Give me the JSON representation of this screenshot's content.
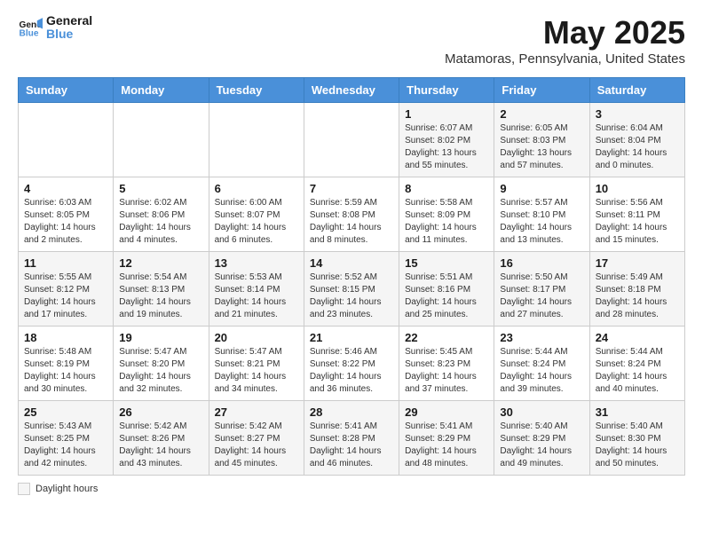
{
  "header": {
    "logo_line1": "General",
    "logo_line2": "Blue",
    "title": "May 2025",
    "subtitle": "Matamoras, Pennsylvania, United States"
  },
  "days_of_week": [
    "Sunday",
    "Monday",
    "Tuesday",
    "Wednesday",
    "Thursday",
    "Friday",
    "Saturday"
  ],
  "weeks": [
    [
      {
        "day": "",
        "info": ""
      },
      {
        "day": "",
        "info": ""
      },
      {
        "day": "",
        "info": ""
      },
      {
        "day": "",
        "info": ""
      },
      {
        "day": "1",
        "info": "Sunrise: 6:07 AM\nSunset: 8:02 PM\nDaylight: 13 hours\nand 55 minutes."
      },
      {
        "day": "2",
        "info": "Sunrise: 6:05 AM\nSunset: 8:03 PM\nDaylight: 13 hours\nand 57 minutes."
      },
      {
        "day": "3",
        "info": "Sunrise: 6:04 AM\nSunset: 8:04 PM\nDaylight: 14 hours\nand 0 minutes."
      }
    ],
    [
      {
        "day": "4",
        "info": "Sunrise: 6:03 AM\nSunset: 8:05 PM\nDaylight: 14 hours\nand 2 minutes."
      },
      {
        "day": "5",
        "info": "Sunrise: 6:02 AM\nSunset: 8:06 PM\nDaylight: 14 hours\nand 4 minutes."
      },
      {
        "day": "6",
        "info": "Sunrise: 6:00 AM\nSunset: 8:07 PM\nDaylight: 14 hours\nand 6 minutes."
      },
      {
        "day": "7",
        "info": "Sunrise: 5:59 AM\nSunset: 8:08 PM\nDaylight: 14 hours\nand 8 minutes."
      },
      {
        "day": "8",
        "info": "Sunrise: 5:58 AM\nSunset: 8:09 PM\nDaylight: 14 hours\nand 11 minutes."
      },
      {
        "day": "9",
        "info": "Sunrise: 5:57 AM\nSunset: 8:10 PM\nDaylight: 14 hours\nand 13 minutes."
      },
      {
        "day": "10",
        "info": "Sunrise: 5:56 AM\nSunset: 8:11 PM\nDaylight: 14 hours\nand 15 minutes."
      }
    ],
    [
      {
        "day": "11",
        "info": "Sunrise: 5:55 AM\nSunset: 8:12 PM\nDaylight: 14 hours\nand 17 minutes."
      },
      {
        "day": "12",
        "info": "Sunrise: 5:54 AM\nSunset: 8:13 PM\nDaylight: 14 hours\nand 19 minutes."
      },
      {
        "day": "13",
        "info": "Sunrise: 5:53 AM\nSunset: 8:14 PM\nDaylight: 14 hours\nand 21 minutes."
      },
      {
        "day": "14",
        "info": "Sunrise: 5:52 AM\nSunset: 8:15 PM\nDaylight: 14 hours\nand 23 minutes."
      },
      {
        "day": "15",
        "info": "Sunrise: 5:51 AM\nSunset: 8:16 PM\nDaylight: 14 hours\nand 25 minutes."
      },
      {
        "day": "16",
        "info": "Sunrise: 5:50 AM\nSunset: 8:17 PM\nDaylight: 14 hours\nand 27 minutes."
      },
      {
        "day": "17",
        "info": "Sunrise: 5:49 AM\nSunset: 8:18 PM\nDaylight: 14 hours\nand 28 minutes."
      }
    ],
    [
      {
        "day": "18",
        "info": "Sunrise: 5:48 AM\nSunset: 8:19 PM\nDaylight: 14 hours\nand 30 minutes."
      },
      {
        "day": "19",
        "info": "Sunrise: 5:47 AM\nSunset: 8:20 PM\nDaylight: 14 hours\nand 32 minutes."
      },
      {
        "day": "20",
        "info": "Sunrise: 5:47 AM\nSunset: 8:21 PM\nDaylight: 14 hours\nand 34 minutes."
      },
      {
        "day": "21",
        "info": "Sunrise: 5:46 AM\nSunset: 8:22 PM\nDaylight: 14 hours\nand 36 minutes."
      },
      {
        "day": "22",
        "info": "Sunrise: 5:45 AM\nSunset: 8:23 PM\nDaylight: 14 hours\nand 37 minutes."
      },
      {
        "day": "23",
        "info": "Sunrise: 5:44 AM\nSunset: 8:24 PM\nDaylight: 14 hours\nand 39 minutes."
      },
      {
        "day": "24",
        "info": "Sunrise: 5:44 AM\nSunset: 8:24 PM\nDaylight: 14 hours\nand 40 minutes."
      }
    ],
    [
      {
        "day": "25",
        "info": "Sunrise: 5:43 AM\nSunset: 8:25 PM\nDaylight: 14 hours\nand 42 minutes."
      },
      {
        "day": "26",
        "info": "Sunrise: 5:42 AM\nSunset: 8:26 PM\nDaylight: 14 hours\nand 43 minutes."
      },
      {
        "day": "27",
        "info": "Sunrise: 5:42 AM\nSunset: 8:27 PM\nDaylight: 14 hours\nand 45 minutes."
      },
      {
        "day": "28",
        "info": "Sunrise: 5:41 AM\nSunset: 8:28 PM\nDaylight: 14 hours\nand 46 minutes."
      },
      {
        "day": "29",
        "info": "Sunrise: 5:41 AM\nSunset: 8:29 PM\nDaylight: 14 hours\nand 48 minutes."
      },
      {
        "day": "30",
        "info": "Sunrise: 5:40 AM\nSunset: 8:29 PM\nDaylight: 14 hours\nand 49 minutes."
      },
      {
        "day": "31",
        "info": "Sunrise: 5:40 AM\nSunset: 8:30 PM\nDaylight: 14 hours\nand 50 minutes."
      }
    ]
  ],
  "legend": {
    "label": "Daylight hours"
  }
}
